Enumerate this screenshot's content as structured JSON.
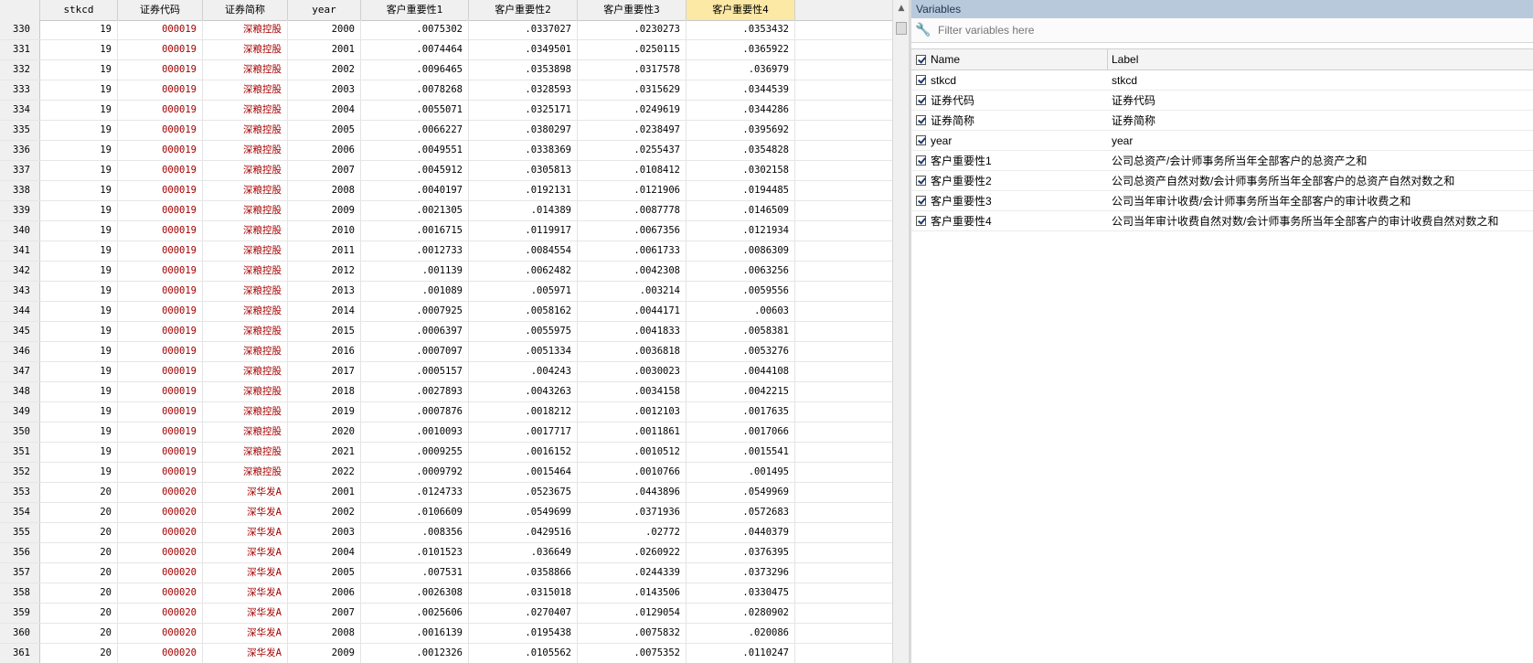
{
  "grid": {
    "columns": [
      "stkcd",
      "证券代码",
      "证券简称",
      "year",
      "客户重要性1",
      "客户重要性2",
      "客户重要性3",
      "客户重要性4"
    ],
    "rows": [
      [
        "330",
        "19",
        "000019",
        "深粮控股",
        "2000",
        ".0075302",
        ".0337027",
        ".0230273",
        ".0353432"
      ],
      [
        "331",
        "19",
        "000019",
        "深粮控股",
        "2001",
        ".0074464",
        ".0349501",
        ".0250115",
        ".0365922"
      ],
      [
        "332",
        "19",
        "000019",
        "深粮控股",
        "2002",
        ".0096465",
        ".0353898",
        ".0317578",
        ".036979"
      ],
      [
        "333",
        "19",
        "000019",
        "深粮控股",
        "2003",
        ".0078268",
        ".0328593",
        ".0315629",
        ".0344539"
      ],
      [
        "334",
        "19",
        "000019",
        "深粮控股",
        "2004",
        ".0055071",
        ".0325171",
        ".0249619",
        ".0344286"
      ],
      [
        "335",
        "19",
        "000019",
        "深粮控股",
        "2005",
        ".0066227",
        ".0380297",
        ".0238497",
        ".0395692"
      ],
      [
        "336",
        "19",
        "000019",
        "深粮控股",
        "2006",
        ".0049551",
        ".0338369",
        ".0255437",
        ".0354828"
      ],
      [
        "337",
        "19",
        "000019",
        "深粮控股",
        "2007",
        ".0045912",
        ".0305813",
        ".0108412",
        ".0302158"
      ],
      [
        "338",
        "19",
        "000019",
        "深粮控股",
        "2008",
        ".0040197",
        ".0192131",
        ".0121906",
        ".0194485"
      ],
      [
        "339",
        "19",
        "000019",
        "深粮控股",
        "2009",
        ".0021305",
        ".014389",
        ".0087778",
        ".0146509"
      ],
      [
        "340",
        "19",
        "000019",
        "深粮控股",
        "2010",
        ".0016715",
        ".0119917",
        ".0067356",
        ".0121934"
      ],
      [
        "341",
        "19",
        "000019",
        "深粮控股",
        "2011",
        ".0012733",
        ".0084554",
        ".0061733",
        ".0086309"
      ],
      [
        "342",
        "19",
        "000019",
        "深粮控股",
        "2012",
        ".001139",
        ".0062482",
        ".0042308",
        ".0063256"
      ],
      [
        "343",
        "19",
        "000019",
        "深粮控股",
        "2013",
        ".001089",
        ".005971",
        ".003214",
        ".0059556"
      ],
      [
        "344",
        "19",
        "000019",
        "深粮控股",
        "2014",
        ".0007925",
        ".0058162",
        ".0044171",
        ".00603"
      ],
      [
        "345",
        "19",
        "000019",
        "深粮控股",
        "2015",
        ".0006397",
        ".0055975",
        ".0041833",
        ".0058381"
      ],
      [
        "346",
        "19",
        "000019",
        "深粮控股",
        "2016",
        ".0007097",
        ".0051334",
        ".0036818",
        ".0053276"
      ],
      [
        "347",
        "19",
        "000019",
        "深粮控股",
        "2017",
        ".0005157",
        ".004243",
        ".0030023",
        ".0044108"
      ],
      [
        "348",
        "19",
        "000019",
        "深粮控股",
        "2018",
        ".0027893",
        ".0043263",
        ".0034158",
        ".0042215"
      ],
      [
        "349",
        "19",
        "000019",
        "深粮控股",
        "2019",
        ".0007876",
        ".0018212",
        ".0012103",
        ".0017635"
      ],
      [
        "350",
        "19",
        "000019",
        "深粮控股",
        "2020",
        ".0010093",
        ".0017717",
        ".0011861",
        ".0017066"
      ],
      [
        "351",
        "19",
        "000019",
        "深粮控股",
        "2021",
        ".0009255",
        ".0016152",
        ".0010512",
        ".0015541"
      ],
      [
        "352",
        "19",
        "000019",
        "深粮控股",
        "2022",
        ".0009792",
        ".0015464",
        ".0010766",
        ".001495"
      ],
      [
        "353",
        "20",
        "000020",
        "深华发A",
        "2001",
        ".0124733",
        ".0523675",
        ".0443896",
        ".0549969"
      ],
      [
        "354",
        "20",
        "000020",
        "深华发A",
        "2002",
        ".0106609",
        ".0549699",
        ".0371936",
        ".0572683"
      ],
      [
        "355",
        "20",
        "000020",
        "深华发A",
        "2003",
        ".008356",
        ".0429516",
        ".02772",
        ".0440379"
      ],
      [
        "356",
        "20",
        "000020",
        "深华发A",
        "2004",
        ".0101523",
        ".036649",
        ".0260922",
        ".0376395"
      ],
      [
        "357",
        "20",
        "000020",
        "深华发A",
        "2005",
        ".007531",
        ".0358866",
        ".0244339",
        ".0373296"
      ],
      [
        "358",
        "20",
        "000020",
        "深华发A",
        "2006",
        ".0026308",
        ".0315018",
        ".0143506",
        ".0330475"
      ],
      [
        "359",
        "20",
        "000020",
        "深华发A",
        "2007",
        ".0025606",
        ".0270407",
        ".0129054",
        ".0280902"
      ],
      [
        "360",
        "20",
        "000020",
        "深华发A",
        "2008",
        ".0016139",
        ".0195438",
        ".0075832",
        ".020086"
      ],
      [
        "361",
        "20",
        "000020",
        "深华发A",
        "2009",
        ".0012326",
        ".0105562",
        ".0075352",
        ".0110247"
      ]
    ],
    "string_color": "#a40000",
    "selected_header_color": "#fde9a6"
  },
  "variables": {
    "title": "Variables",
    "filter_placeholder": "Filter variables here",
    "col_name": "Name",
    "col_label": "Label",
    "items": [
      {
        "name": "stkcd",
        "label": "stkcd"
      },
      {
        "name": "证券代码",
        "label": "证券代码"
      },
      {
        "name": "证券简称",
        "label": "证券简称"
      },
      {
        "name": "year",
        "label": "year"
      },
      {
        "name": "客户重要性1",
        "label": "公司总资产/会计师事务所当年全部客户的总资产之和"
      },
      {
        "name": "客户重要性2",
        "label": "公司总资产自然对数/会计师事务所当年全部客户的总资产自然对数之和"
      },
      {
        "name": "客户重要性3",
        "label": "公司当年审计收费/会计师事务所当年全部客户的审计收费之和"
      },
      {
        "name": "客户重要性4",
        "label": "公司当年审计收费自然对数/会计师事务所当年全部客户的审计收费自然对数之和"
      }
    ]
  }
}
